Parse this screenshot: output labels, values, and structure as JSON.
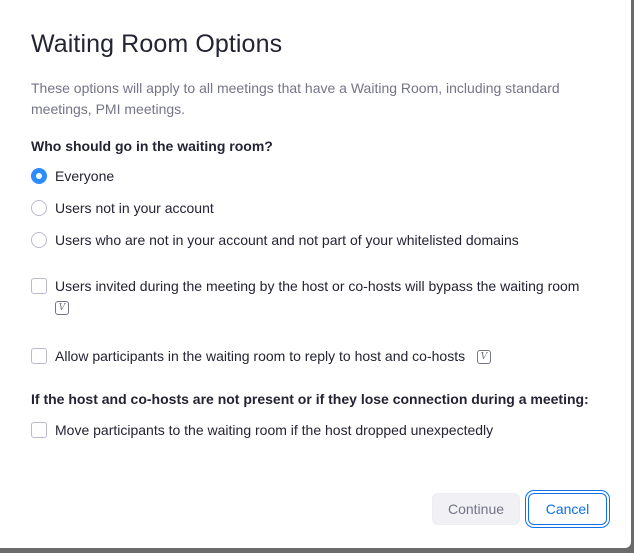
{
  "dialog": {
    "title": "Waiting Room Options",
    "description": "These options will apply to all meetings that have a Waiting Room, including standard meetings, PMI meetings."
  },
  "who_section": {
    "heading": "Who should go in the waiting room?",
    "options": [
      {
        "label": "Everyone",
        "checked": true
      },
      {
        "label": "Users not in your account",
        "checked": false
      },
      {
        "label": "Users who are not in your account and not part of your whitelisted domains",
        "checked": false
      }
    ]
  },
  "extra_options": [
    {
      "label": "Users invited during the meeting by the host or co-hosts will bypass the waiting room",
      "checked": false,
      "icon": "v-info-icon"
    },
    {
      "label": "Allow participants in the waiting room to reply to host and co-hosts",
      "checked": false,
      "icon": "v-info-icon"
    }
  ],
  "host_section": {
    "heading": "If the host and co-hosts are not present or if they lose connection during a meeting:",
    "options": [
      {
        "label": "Move participants to the waiting room if the host dropped unexpectedly",
        "checked": false
      }
    ]
  },
  "icon_glyph": "V",
  "buttons": {
    "continue_label": "Continue",
    "cancel_label": "Cancel"
  },
  "colors": {
    "accent": "#2d8cff",
    "link_blue": "#0e71eb",
    "muted_text": "#747487"
  }
}
